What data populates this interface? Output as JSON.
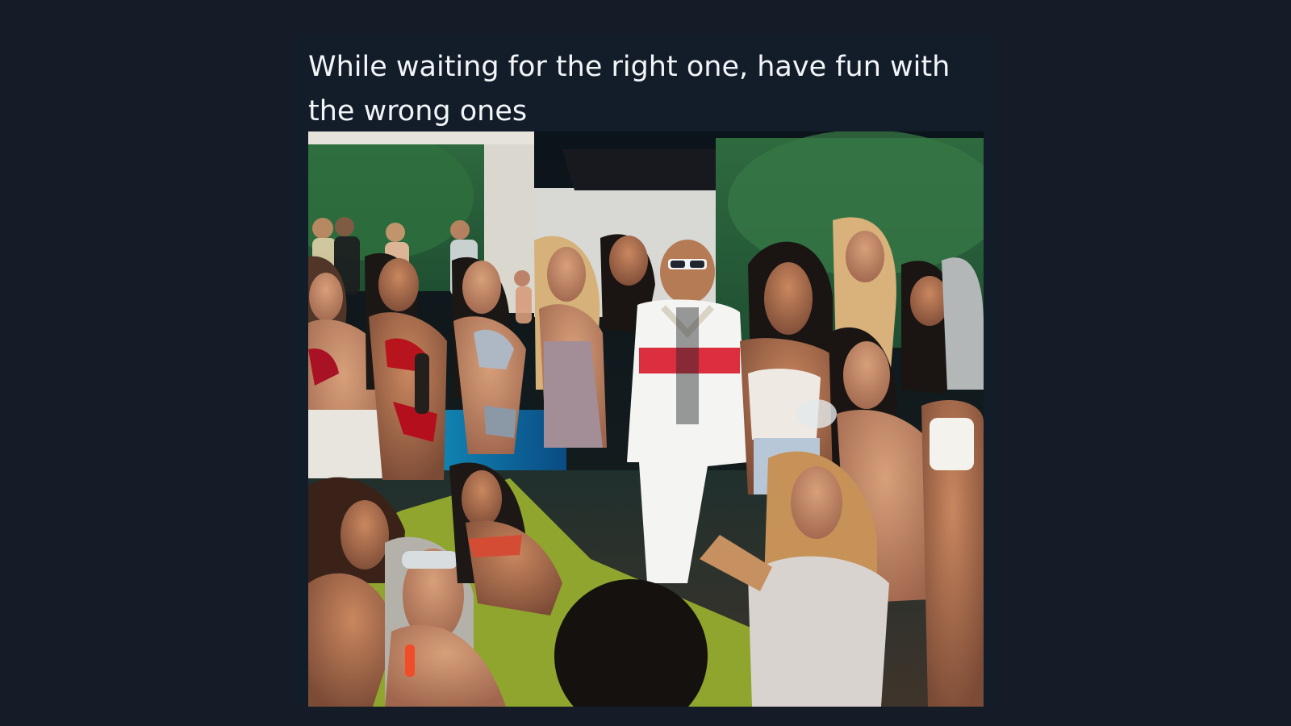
{
  "post": {
    "caption": "While waiting for the right one, have fun with the wrong ones",
    "image_icon": "party-photo-icon"
  },
  "colors": {
    "page_background": "#161c27",
    "card_background": "#131d29",
    "text": "#f2f5f8"
  }
}
